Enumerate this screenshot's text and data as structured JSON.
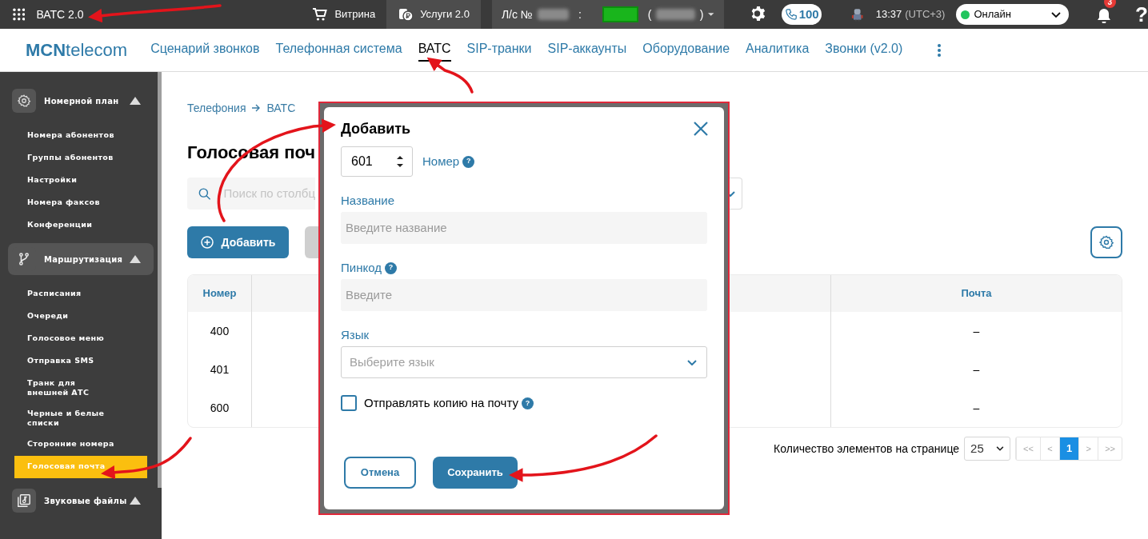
{
  "top_bar": {
    "app_title": "ВАТС 2.0",
    "links": [
      {
        "label": "Витрина",
        "selected": false
      },
      {
        "label": "Услуги 2.0",
        "selected": true
      }
    ],
    "account": {
      "label": "Л/с №",
      "separator": ":",
      "paren_open": "(",
      "paren_close": ")"
    },
    "calls_count": "100",
    "time": "13:37",
    "timezone": "(UTC+3)",
    "status": {
      "label": "Онлайн",
      "color": "#22c55e"
    },
    "notifications_count": "3",
    "help": "?"
  },
  "nav": {
    "logo_bold": "MCN",
    "logo_rest": "telecom",
    "items": [
      {
        "label": "Сценарий звонков",
        "selected": false
      },
      {
        "label": "Телефонная система",
        "selected": false
      },
      {
        "label": "ВАТС",
        "selected": true
      },
      {
        "label": "SIP-транки",
        "selected": false
      },
      {
        "label": "SIP-аккаунты",
        "selected": false
      },
      {
        "label": "Оборудование",
        "selected": false
      },
      {
        "label": "Аналитика",
        "selected": false
      },
      {
        "label": "Звонки (v2.0)",
        "selected": false
      }
    ]
  },
  "sidebar": {
    "sections": [
      {
        "title": "Номерной план",
        "selected": false,
        "expanded": true,
        "children": [
          {
            "label": "Номера абонентов",
            "selected": false
          },
          {
            "label": "Группы абонентов",
            "selected": false
          },
          {
            "label": "Настройки",
            "selected": false
          },
          {
            "label": "Номера факсов",
            "selected": false
          },
          {
            "label": "Конференции",
            "selected": false
          }
        ]
      },
      {
        "title": "Маршрутизация",
        "selected": true,
        "expanded": true,
        "children": [
          {
            "label": "Расписания",
            "selected": false
          },
          {
            "label": "Очереди",
            "selected": false
          },
          {
            "label": "Голосовое меню",
            "selected": false
          },
          {
            "label": "Отправка SMS",
            "selected": false
          },
          {
            "label": "Транк для внешней АТС",
            "selected": false
          },
          {
            "label": "Черные и белые списки",
            "selected": false
          },
          {
            "label": "Сторонние номера",
            "selected": false
          },
          {
            "label": "Голосовая почта",
            "selected": true
          }
        ]
      },
      {
        "title": "Звуковые файлы",
        "selected": false,
        "expanded": true
      }
    ]
  },
  "breadcrumb": [
    "Телефония",
    "ВАТС"
  ],
  "page_title": "Голосовая поч",
  "search": {
    "placeholder": "Поиск по столбц"
  },
  "add_button": "Добавить",
  "table": {
    "columns": [
      {
        "label": "Номер"
      },
      {
        "label": "Почта"
      }
    ],
    "rows": [
      {
        "number": "400",
        "mail": "–"
      },
      {
        "number": "401",
        "mail": "–"
      },
      {
        "number": "600",
        "mail": "–"
      }
    ]
  },
  "pagination": {
    "per_page_label": "Количество элементов на странице",
    "per_page": "25",
    "pages": [
      {
        "label": "<<",
        "selected": false
      },
      {
        "label": "<",
        "selected": false
      },
      {
        "label": "1",
        "selected": true
      },
      {
        "label": ">",
        "selected": false
      },
      {
        "label": ">>",
        "selected": false
      }
    ]
  },
  "dialog": {
    "title": "Добавить",
    "number_value": "601",
    "number_label": "Номер",
    "number_help": "?",
    "name_label": "Название",
    "name_placeholder": "Введите название",
    "pin_label": "Пинкод",
    "pin_help": "?",
    "pin_placeholder": "Введите",
    "language_label": "Язык",
    "language_placeholder": "Выберите язык",
    "copy_to_mail": {
      "label": "Отправлять копию на почту",
      "checked": false,
      "help": "?"
    },
    "cancel_button": "Отмена",
    "save_button": "Сохранить"
  }
}
